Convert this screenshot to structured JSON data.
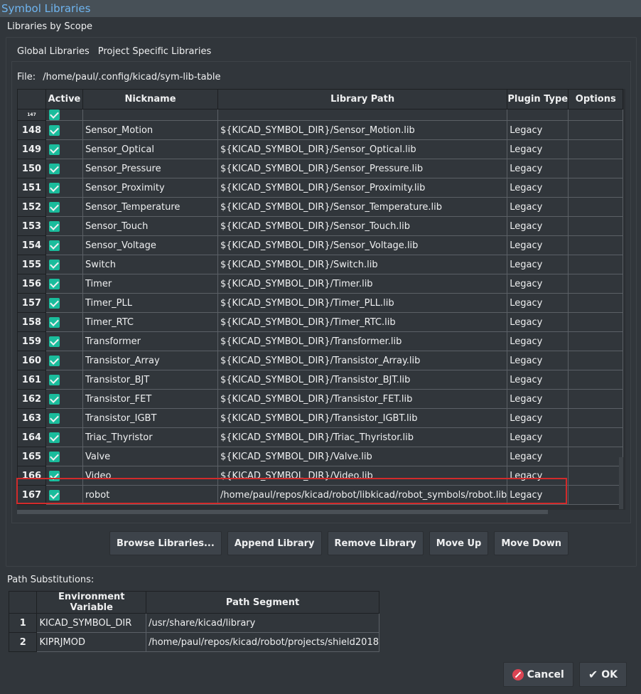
{
  "window": {
    "title": "Symbol Libraries"
  },
  "scope_label": "Libraries by Scope",
  "tabs": [
    {
      "label": "Global Libraries",
      "active": true
    },
    {
      "label": "Project Specific Libraries",
      "active": false
    }
  ],
  "file": {
    "label": "File:",
    "path": "/home/paul/.config/kicad/sym-lib-table"
  },
  "libtable": {
    "columns": [
      "Active",
      "Nickname",
      "Library Path",
      "Plugin Type",
      "Options"
    ],
    "rows": [
      {
        "num": "147",
        "active": true,
        "nickname": "",
        "path": "",
        "plugin": ""
      },
      {
        "num": "148",
        "active": true,
        "nickname": "Sensor_Motion",
        "path": "${KICAD_SYMBOL_DIR}/Sensor_Motion.lib",
        "plugin": "Legacy"
      },
      {
        "num": "149",
        "active": true,
        "nickname": "Sensor_Optical",
        "path": "${KICAD_SYMBOL_DIR}/Sensor_Optical.lib",
        "plugin": "Legacy"
      },
      {
        "num": "150",
        "active": true,
        "nickname": "Sensor_Pressure",
        "path": "${KICAD_SYMBOL_DIR}/Sensor_Pressure.lib",
        "plugin": "Legacy"
      },
      {
        "num": "151",
        "active": true,
        "nickname": "Sensor_Proximity",
        "path": "${KICAD_SYMBOL_DIR}/Sensor_Proximity.lib",
        "plugin": "Legacy"
      },
      {
        "num": "152",
        "active": true,
        "nickname": "Sensor_Temperature",
        "path": "${KICAD_SYMBOL_DIR}/Sensor_Temperature.lib",
        "plugin": "Legacy"
      },
      {
        "num": "153",
        "active": true,
        "nickname": "Sensor_Touch",
        "path": "${KICAD_SYMBOL_DIR}/Sensor_Touch.lib",
        "plugin": "Legacy"
      },
      {
        "num": "154",
        "active": true,
        "nickname": "Sensor_Voltage",
        "path": "${KICAD_SYMBOL_DIR}/Sensor_Voltage.lib",
        "plugin": "Legacy"
      },
      {
        "num": "155",
        "active": true,
        "nickname": "Switch",
        "path": "${KICAD_SYMBOL_DIR}/Switch.lib",
        "plugin": "Legacy"
      },
      {
        "num": "156",
        "active": true,
        "nickname": "Timer",
        "path": "${KICAD_SYMBOL_DIR}/Timer.lib",
        "plugin": "Legacy"
      },
      {
        "num": "157",
        "active": true,
        "nickname": "Timer_PLL",
        "path": "${KICAD_SYMBOL_DIR}/Timer_PLL.lib",
        "plugin": "Legacy"
      },
      {
        "num": "158",
        "active": true,
        "nickname": "Timer_RTC",
        "path": "${KICAD_SYMBOL_DIR}/Timer_RTC.lib",
        "plugin": "Legacy"
      },
      {
        "num": "159",
        "active": true,
        "nickname": "Transformer",
        "path": "${KICAD_SYMBOL_DIR}/Transformer.lib",
        "plugin": "Legacy"
      },
      {
        "num": "160",
        "active": true,
        "nickname": "Transistor_Array",
        "path": "${KICAD_SYMBOL_DIR}/Transistor_Array.lib",
        "plugin": "Legacy"
      },
      {
        "num": "161",
        "active": true,
        "nickname": "Transistor_BJT",
        "path": "${KICAD_SYMBOL_DIR}/Transistor_BJT.lib",
        "plugin": "Legacy"
      },
      {
        "num": "162",
        "active": true,
        "nickname": "Transistor_FET",
        "path": "${KICAD_SYMBOL_DIR}/Transistor_FET.lib",
        "plugin": "Legacy"
      },
      {
        "num": "163",
        "active": true,
        "nickname": "Transistor_IGBT",
        "path": "${KICAD_SYMBOL_DIR}/Transistor_IGBT.lib",
        "plugin": "Legacy"
      },
      {
        "num": "164",
        "active": true,
        "nickname": "Triac_Thyristor",
        "path": "${KICAD_SYMBOL_DIR}/Triac_Thyristor.lib",
        "plugin": "Legacy"
      },
      {
        "num": "165",
        "active": true,
        "nickname": "Valve",
        "path": "${KICAD_SYMBOL_DIR}/Valve.lib",
        "plugin": "Legacy"
      },
      {
        "num": "166",
        "active": true,
        "nickname": "Video",
        "path": "${KICAD_SYMBOL_DIR}/Video.lib",
        "plugin": "Legacy"
      },
      {
        "num": "167",
        "active": true,
        "nickname": "robot",
        "path": "/home/paul/repos/kicad/robot/libkicad/robot_symbols/robot.lib",
        "plugin": "Legacy"
      }
    ]
  },
  "buttons": {
    "browse": "Browse Libraries...",
    "append": "Append Library",
    "remove": "Remove Library",
    "move_up": "Move Up",
    "move_down": "Move Down"
  },
  "path_subs": {
    "label": "Path Substitutions:",
    "columns": [
      "Environment Variable",
      "Path Segment"
    ],
    "rows": [
      {
        "num": "1",
        "var": "KICAD_SYMBOL_DIR",
        "path": "/usr/share/kicad/library"
      },
      {
        "num": "2",
        "var": "KIPRJMOD",
        "path": "/home/paul/repos/kicad/robot/projects/shield2018"
      }
    ]
  },
  "dialog": {
    "cancel": "Cancel",
    "ok": "OK"
  }
}
